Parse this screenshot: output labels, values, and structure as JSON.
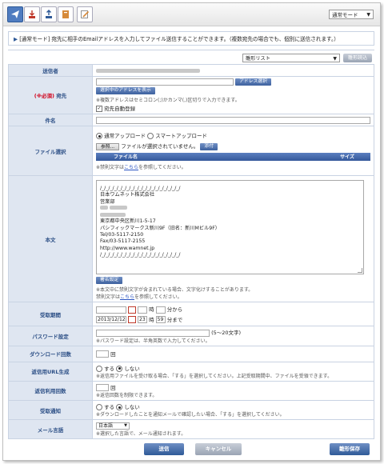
{
  "toolbar": {
    "icons": [
      "send-icon",
      "download-icon",
      "upload-icon",
      "address-book-icon",
      "edit-icon"
    ],
    "mode_select": "通常モード"
  },
  "notice": {
    "tag": "[通常モード]",
    "text": "宛先に相手のEmailアドレスを入力してファイル送信することができます。（複数宛先の場合でも、個別に送信されます。）"
  },
  "template": {
    "select_value": "雛形リスト",
    "load_button": "雛形読込"
  },
  "form": {
    "sender": {
      "label": "送信者"
    },
    "recipient": {
      "label_req": "(※必須)",
      "label": "宛先",
      "address_button": "アドレス選択",
      "show_selected_button": "選択中のアドレスを表示",
      "note": "※複数アドレスはセミコロン(;)かカンマ(,)区切りで入力できます。",
      "auto_register": "宛先自動登録",
      "auto_register_checked": true
    },
    "subject": {
      "label": "件名"
    },
    "file": {
      "label": "ファイル選択",
      "option_normal": "通常アップロード",
      "option_smart": "スマートアップロード",
      "browse_button": "参照...",
      "no_file_text": "ファイルが選択されていません。",
      "attach_button": "添付",
      "col_name": "ファイル名",
      "col_size": "サイズ",
      "note_pre": "※禁則文字は",
      "note_link": "こちら",
      "note_post": "を参照してください。"
    },
    "body": {
      "label": "本文",
      "lines": [
        "/_/_/_/_/_/_/_/_/_/_/_/_/_/_/_/_/_/_/_/",
        "日本ワムネット株式会社",
        "営業部",
        "",
        "",
        "東京都中央区新川1-5-17",
        "パシフィックマークス新川9F（旧名：新川Mビル9F）",
        "Tel/03-5117-2150",
        "Fax/03-5117-2155",
        "http://www.wamnet.jp",
        "/_/_/_/_/_/_/_/_/_/_/_/_/_/_/_/_/_/_/_/"
      ],
      "signature_button": "署名設定",
      "note1": "※本文中に禁則文字が含まれている場合、文字化けすることがあります。",
      "note2_pre": "禁則文字は",
      "note2_link": "こちら",
      "note2_post": "を参照してください。"
    },
    "period": {
      "label": "受取期間",
      "hour_unit": "時",
      "min_from": "分から",
      "end_date": "2013/12/12",
      "end_hour": "23",
      "end_min": "59",
      "min_until": "分まで"
    },
    "password": {
      "label": "パスワード設定",
      "range": "(5〜20文字)",
      "note": "※パスワード設定は、半角英数で入力してください。"
    },
    "download_count": {
      "label": "ダウンロード回数",
      "unit": "回"
    },
    "reply_url": {
      "label": "返信用URL生成",
      "yes": "する",
      "no": "しない",
      "selected": "no",
      "note": "※返信用ファイルを受け取る場合、「する」を選択してください。上記受取期間中、ファイルを受領できます。"
    },
    "reply_count": {
      "label": "返信利用回数",
      "unit": "回",
      "note": "※返信回数を制限できます。"
    },
    "receipt_notice": {
      "label": "受取通知",
      "yes": "する",
      "no": "しない",
      "selected": "no",
      "note": "※ダウンロードしたことを通知メールで確認したい場合、「する」を選択してください。"
    },
    "mail_lang": {
      "label": "メール言語",
      "value": "日本語",
      "note": "※選択した言語で、メール通知されます。"
    }
  },
  "actions": {
    "send": "送信",
    "cancel": "キャンセル",
    "save_template": "雛形保存"
  },
  "colors": {
    "label_bg": "#dfe6f1",
    "label_text": "#2c4f86",
    "primary_button": "#3e629f",
    "required": "#d0021b"
  }
}
